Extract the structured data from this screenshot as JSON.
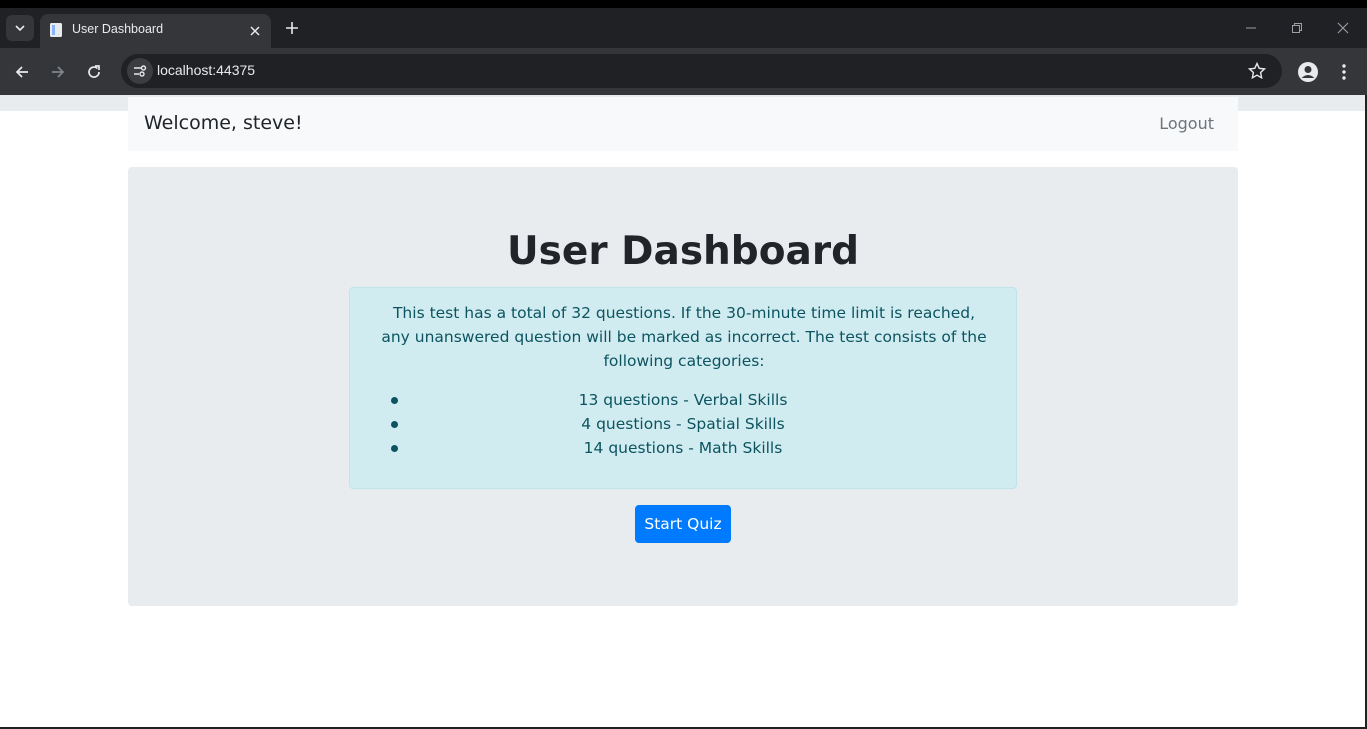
{
  "browser": {
    "tab_title": "User Dashboard",
    "url": "localhost:44375"
  },
  "navbar": {
    "welcome": "Welcome, steve!",
    "logout": "Logout"
  },
  "dashboard": {
    "title": "User Dashboard",
    "intro": "This test has a total of 32 questions. If the 30-minute time limit is reached, any unanswered question will be marked as incorrect. The test consists of the following categories:",
    "categories": [
      "13 questions - Verbal Skills",
      "4 questions - Spatial Skills",
      "14 questions - Math Skills"
    ],
    "start_button": "Start Quiz"
  },
  "colors": {
    "primary": "#007bff",
    "info_bg": "#d1ecf1",
    "info_text": "#0c5460",
    "jumbotron_bg": "#e9ecef"
  },
  "icons": [
    "tab-search-icon",
    "page-favicon-icon",
    "close-icon",
    "plus-icon",
    "minimize-icon",
    "restore-icon",
    "window-close-icon",
    "back-arrow-icon",
    "forward-arrow-icon",
    "reload-icon",
    "site-info-icon",
    "bookmark-star-icon",
    "profile-icon",
    "menu-dots-icon"
  ]
}
